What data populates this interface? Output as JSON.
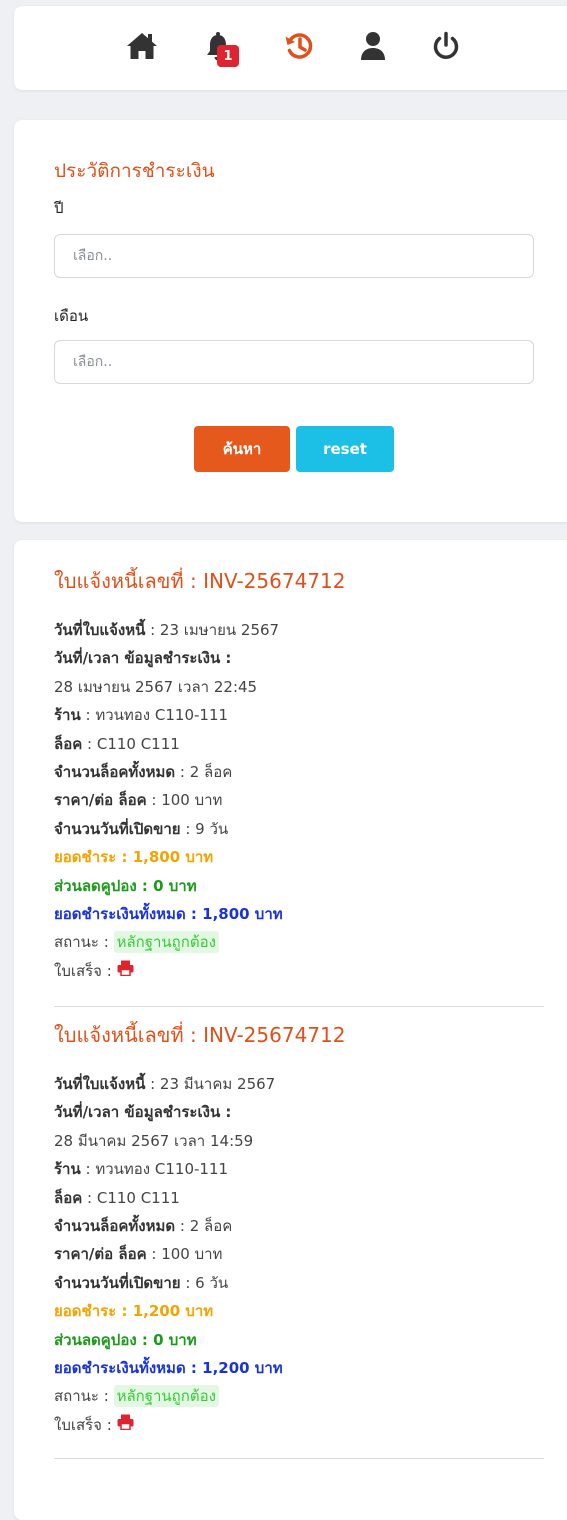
{
  "nav": {
    "notification_count": "1",
    "icons": [
      "home-icon",
      "bell-icon",
      "history-icon",
      "user-icon",
      "power-icon"
    ],
    "accent_color": "#e0501a"
  },
  "form": {
    "title": "ประวัติการชำระเงิน",
    "year_label": "ปี",
    "year_placeholder": "เลือก..",
    "month_label": "เดือน",
    "month_placeholder": "เลือก..",
    "search_label": "ค้นหา",
    "reset_label": "reset"
  },
  "invoices": [
    {
      "title": "ใบแจ้งหนี้เลขที่ : INV-25674712",
      "invoice_date_label": "วันที่ใบแจ้งหนี้",
      "invoice_date": " : 23 เมษายน 2567",
      "payment_label": "วันที่/เวลา ข้อมูลชำระเงิน :",
      "payment_datetime": "28 เมษายน 2567 เวลา 22:45",
      "shop_label": "ร้าน",
      "shop": " : ทวนทอง C110-111",
      "lock_label": "ล็อค",
      "lock": " : C110 C111",
      "total_locks_label": "จำนวนล็อคทั้งหมด",
      "total_locks": " : 2 ล็อค",
      "price_label": "ราคา/ต่อ ล็อค",
      "price": " : 100 บาท",
      "days_label": "จำนวนวันที่เปิดขาย",
      "days": " : 9 วัน",
      "amount": "ยอดชำระ : 1,800 บาท",
      "discount": "ส่วนลดคูปอง : 0 บาท",
      "total": "ยอดชำระเงินทั้งหมด : 1,800 บาท",
      "status_label": "สถานะ : ",
      "status": "หลักฐานถูกต้อง",
      "receipt_label": "ใบเสร็จ : "
    },
    {
      "title": "ใบแจ้งหนี้เลขที่ : INV-25674712",
      "invoice_date_label": "วันที่ใบแจ้งหนี้",
      "invoice_date": " : 23 มีนาคม 2567",
      "payment_label": "วันที่/เวลา ข้อมูลชำระเงิน :",
      "payment_datetime": "28 มีนาคม 2567 เวลา 14:59",
      "shop_label": "ร้าน",
      "shop": " : ทวนทอง C110-111",
      "lock_label": "ล็อค",
      "lock": " : C110 C111",
      "total_locks_label": "จำนวนล็อคทั้งหมด",
      "total_locks": " : 2 ล็อค",
      "price_label": "ราคา/ต่อ ล็อค",
      "price": " : 100 บาท",
      "days_label": "จำนวนวันที่เปิดขาย",
      "days": " : 6 วัน",
      "amount": "ยอดชำระ : 1,200 บาท",
      "discount": "ส่วนลดคูปอง : 0 บาท",
      "total": "ยอดชำระเงินทั้งหมด : 1,200 บาท",
      "status_label": "สถานะ : ",
      "status": "หลักฐานถูกต้อง",
      "receipt_label": "ใบเสร็จ : "
    }
  ]
}
